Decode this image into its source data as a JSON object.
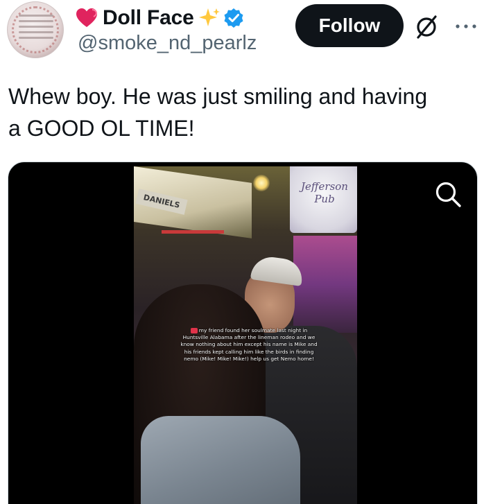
{
  "tweet": {
    "author": {
      "display_name": "Doll Face",
      "handle": "@smoke_nd_pearlz",
      "verified": true,
      "name_emojis": [
        "heart-icon",
        "sparkle-icon"
      ]
    },
    "follow_label": "Follow",
    "text_line1": "Whew boy. He was just smiling and having",
    "text_line2": "a GOOD OL TIME!"
  },
  "media": {
    "sign_left": "DANIELS",
    "sign_right": "Jefferson Pub",
    "caption": "my friend found her soulmate last night in Huntsville Alabama after the lineman rodeo and we know nothing about him except his name is Mike and his friends kept calling him like the birds in finding nemo (Mike! Mike! Mike!) help us get Nemo home!"
  },
  "colors": {
    "text": "#0f1419",
    "secondary_text": "#536471",
    "verified_blue": "#1d9bf0",
    "follow_bg": "#0f1419",
    "heart": "#e0245e",
    "sparkle": "#ffc83d"
  },
  "icons": {
    "grok": "grok-icon",
    "more": "more-icon",
    "search": "search-icon",
    "verified": "verified-icon"
  }
}
